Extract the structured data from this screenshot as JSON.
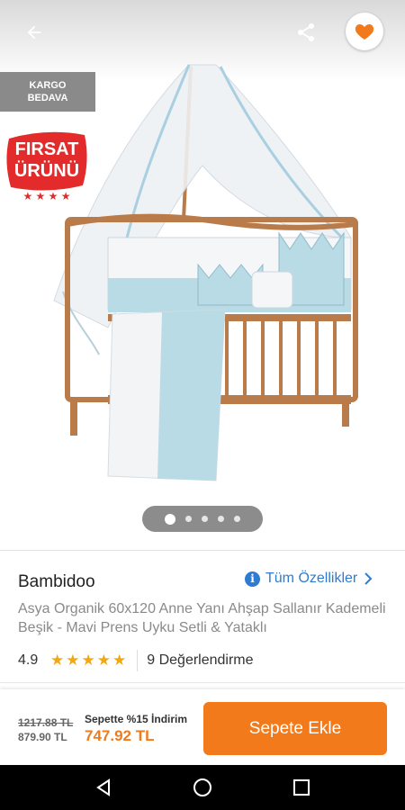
{
  "header": {
    "back_icon": "arrow-left-icon",
    "share_icon": "share-icon",
    "favorite_icon": "heart-icon",
    "accent": "#f27a1a"
  },
  "badges": {
    "cargo_line1": "KARGO",
    "cargo_line2": "BEDAVA",
    "firsat_line1": "FIRSAT",
    "firsat_line2": "ÜRÜNÜ"
  },
  "gallery": {
    "image_count": 5,
    "active_index": 0
  },
  "product": {
    "brand": "Bambidoo",
    "all_features_label": "Tüm Özellikler",
    "title": "Asya Organik 60x120 Anne Yanı Ahşap Sallanır Kademeli Beşik - Mavi Prens Uyku Setli & Yataklı",
    "rating": "4.9",
    "stars": 5,
    "reviews_label": "9 Değerlendirme"
  },
  "pricing": {
    "old_price": "1217.88 TL",
    "price": "879.90 TL",
    "discount_label": "Sepette %15 İndirim",
    "final_price": "747.92 TL",
    "add_to_cart_label": "Sepete Ekle"
  },
  "system_nav": {
    "back": "triangle-back-icon",
    "home": "circle-home-icon",
    "recents": "square-recents-icon"
  }
}
